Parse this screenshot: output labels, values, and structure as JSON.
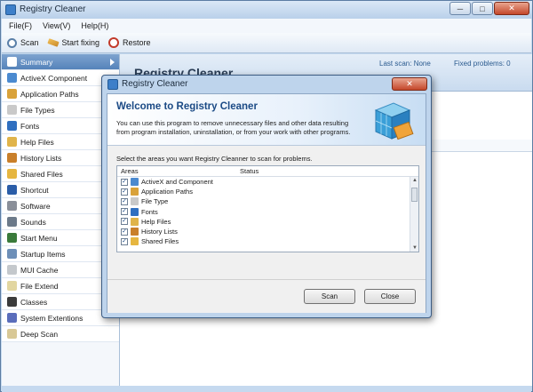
{
  "window": {
    "title": "Registry Cleaner",
    "minimize": "─",
    "maximize": "□",
    "close": "✕"
  },
  "menu": [
    "File(F)",
    "View(V)",
    "Help(H)"
  ],
  "toolbar": {
    "scan": "Scan",
    "start_fixing": "Start fixing",
    "restore": "Restore"
  },
  "sidebar": {
    "items": [
      {
        "label": "Summary",
        "color": "#4a7ab3"
      },
      {
        "label": "ActiveX Component",
        "color": "#4b8ad0"
      },
      {
        "label": "Application Paths",
        "color": "#d9a23a"
      },
      {
        "label": "File Types",
        "color": "#c9c9c9"
      },
      {
        "label": "Fonts",
        "color": "#2f6fc0"
      },
      {
        "label": "Help Files",
        "color": "#e0b44a"
      },
      {
        "label": "History Lists",
        "color": "#c97f2a"
      },
      {
        "label": "Shared Files",
        "color": "#e6b640"
      },
      {
        "label": "Shortcut",
        "color": "#2a5da8"
      },
      {
        "label": "Software",
        "color": "#8a8f99"
      },
      {
        "label": "Sounds",
        "color": "#6c7a8a"
      },
      {
        "label": "Start Menu",
        "color": "#3a7a3a"
      },
      {
        "label": "Startup Items",
        "color": "#6d8fb8"
      },
      {
        "label": "MUI Cache",
        "color": "#c4c8cc"
      },
      {
        "label": "File Extend",
        "color": "#e2d6a0"
      },
      {
        "label": "Classes",
        "color": "#3b3b3b"
      },
      {
        "label": "System Extentions",
        "color": "#5a6dbb"
      },
      {
        "label": "Deep Scan",
        "color": "#d8c896"
      }
    ]
  },
  "content": {
    "title": "Registry Cleaner",
    "last_scan": "Last scan: None",
    "fixed_problems": "Fixed problems:  0"
  },
  "dialog": {
    "title": "Registry Cleaner",
    "close": "✕",
    "heading": "Welcome to Registry Cleaner",
    "description": "You can use this program to remove unnecessary files and other data resulting from program installation, uninstallation, or from your work with other programs.",
    "instruction": "Select the areas you want Registry Cleanner to scan for problems.",
    "col_areas": "Areas",
    "col_status": "Status",
    "areas": [
      {
        "label": "ActiveX and Component",
        "color": "#4b8ad0"
      },
      {
        "label": "Application Paths",
        "color": "#d9a23a"
      },
      {
        "label": "File Type",
        "color": "#c9c9c9"
      },
      {
        "label": "Fonts",
        "color": "#2f6fc0"
      },
      {
        "label": "Help Files",
        "color": "#e0b44a"
      },
      {
        "label": "History Lists",
        "color": "#c97f2a"
      },
      {
        "label": "Shared Files",
        "color": "#e6b640"
      }
    ],
    "check_mark": "✓",
    "scan_button": "Scan",
    "close_button": "Close"
  }
}
